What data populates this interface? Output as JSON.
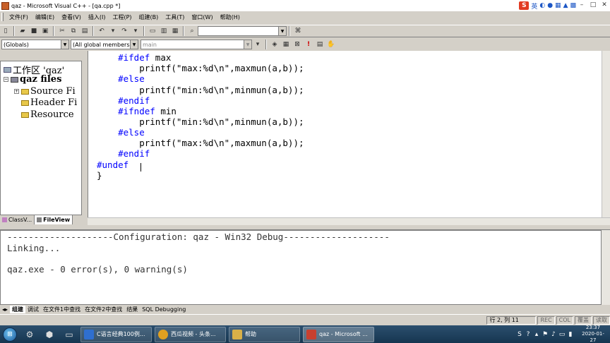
{
  "window": {
    "title": "qaz - Microsoft Visual C++ - [qa.cpp *]"
  },
  "ime": {
    "logo": "S",
    "lang": "英",
    "icons": [
      "moon-icon",
      "mic-icon",
      "keyboard-icon",
      "shirt-icon",
      "grid-icon"
    ]
  },
  "menu": {
    "items": [
      "文件(F)",
      "编辑(E)",
      "查看(V)",
      "插入(I)",
      "工程(P)",
      "组建(B)",
      "工具(T)",
      "窗口(W)",
      "帮助(H)"
    ]
  },
  "toolbar": {
    "find_value": ""
  },
  "toolbar2": {
    "globals_combo": "(Globals)",
    "members_combo": "(All global members",
    "function_combo": "main"
  },
  "workspace": {
    "root": "工作区 'qaz'",
    "project": "qaz files",
    "folders": [
      "Source Fi",
      "Header Fi",
      "Resource"
    ],
    "tabs": [
      "ClassV...",
      "FileView"
    ]
  },
  "editor": {
    "lines": [
      {
        "indent": "    ",
        "kw": "#ifdef",
        "text": " max"
      },
      {
        "indent": "        ",
        "kw": "",
        "text": "printf(\"max:%d\\n\",maxmun(a,b));"
      },
      {
        "indent": "    ",
        "kw": "#else",
        "text": ""
      },
      {
        "indent": "        ",
        "kw": "",
        "text": "printf(\"min:%d\\n\",minmun(a,b));"
      },
      {
        "indent": "    ",
        "kw": "#endif",
        "text": ""
      },
      {
        "indent": "    ",
        "kw": "#ifndef",
        "text": " min"
      },
      {
        "indent": "        ",
        "kw": "",
        "text": "printf(\"min:%d\\n\",minmun(a,b));"
      },
      {
        "indent": "    ",
        "kw": "#else",
        "text": ""
      },
      {
        "indent": "        ",
        "kw": "",
        "text": "printf(\"max:%d\\n\",maxmun(a,b));"
      },
      {
        "indent": "    ",
        "kw": "#endif",
        "text": ""
      },
      {
        "indent": "",
        "kw": "#undef",
        "text": ""
      },
      {
        "indent": "",
        "kw": "",
        "text": "}"
      }
    ]
  },
  "output": {
    "lines": [
      "--------------------Configuration: qaz - Win32 Debug--------------------",
      "Linking...",
      "",
      "qaz.exe - 0 error(s), 0 warning(s)"
    ],
    "tabs": [
      "组建",
      "调试",
      "在文件1中查找",
      "在文件2中查找",
      "结果",
      "SQL Debugging"
    ]
  },
  "status": {
    "position": "行 2, 列 11",
    "rec": "REC",
    "col": "COL",
    "ovr": "覆盖",
    "read": "读取"
  },
  "taskbar": {
    "items": [
      {
        "label": "C语言经典100例...",
        "color": "#2f6fd0"
      },
      {
        "label": "西瓜视频 - 头条...",
        "color": "#e0a020"
      },
      {
        "label": "帮助",
        "color": "#d8b048"
      },
      {
        "label": "qaz - Microsoft ...",
        "color": "#c84030"
      }
    ],
    "time": "23:37",
    "date": "2020-01-27"
  }
}
